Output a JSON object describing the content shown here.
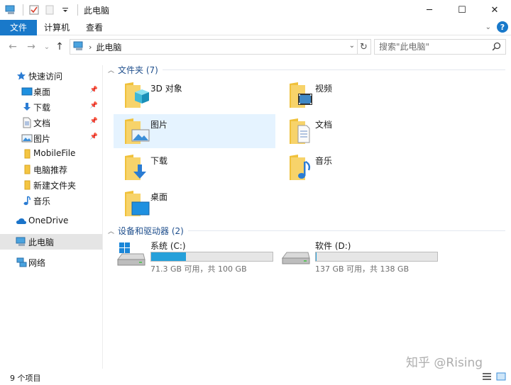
{
  "window": {
    "title": "此电脑",
    "controls": {
      "minimize": "─",
      "maximize": "☐",
      "close": "✕"
    }
  },
  "ribbon": {
    "tabs": [
      {
        "label": "文件"
      },
      {
        "label": "计算机"
      },
      {
        "label": "查看"
      }
    ],
    "help": "?",
    "expand": "⌄"
  },
  "nav": {
    "back": "←",
    "forward": "→",
    "recent": "⌄",
    "up": "↑",
    "breadcrumb": "此电脑",
    "dropdown": "⌄",
    "refresh": "↻",
    "search_placeholder": "搜索\"此电脑\""
  },
  "sidebar": {
    "quick_access": "快速访问",
    "items": [
      {
        "label": "桌面",
        "icon": "desktop-icon",
        "pinned": true
      },
      {
        "label": "下载",
        "icon": "download-icon",
        "pinned": true
      },
      {
        "label": "文档",
        "icon": "document-icon",
        "pinned": true
      },
      {
        "label": "图片",
        "icon": "picture-icon",
        "pinned": true
      },
      {
        "label": "MobileFile",
        "icon": "folder-icon",
        "pinned": false
      },
      {
        "label": "电脑推荐",
        "icon": "folder-icon",
        "pinned": false
      },
      {
        "label": "新建文件夹",
        "icon": "folder-icon",
        "pinned": false
      },
      {
        "label": "音乐",
        "icon": "music-icon",
        "pinned": false
      }
    ],
    "onedrive": "OneDrive",
    "this_pc": "此电脑",
    "network": "网络"
  },
  "folders_group": {
    "title": "文件夹 (7)",
    "items": [
      {
        "label": "3D 对象",
        "icon": "3d-objects-icon"
      },
      {
        "label": "视频",
        "icon": "video-icon"
      },
      {
        "label": "图片",
        "icon": "picture-icon"
      },
      {
        "label": "文档",
        "icon": "document-icon"
      },
      {
        "label": "下载",
        "icon": "download-icon"
      },
      {
        "label": "音乐",
        "icon": "music-icon"
      },
      {
        "label": "桌面",
        "icon": "desktop-icon"
      }
    ]
  },
  "drives_group": {
    "title": "设备和驱动器 (2)",
    "items": [
      {
        "label": "系统 (C:)",
        "free": "71.3 GB 可用，共 100 GB",
        "used_fraction": 0.287,
        "icon": "windows-drive-icon"
      },
      {
        "label": "软件 (D:)",
        "free": "137 GB 可用，共 138 GB",
        "used_fraction": 0.007,
        "icon": "drive-icon"
      }
    ]
  },
  "status": {
    "item_count": "9 个项目"
  },
  "watermark": "知乎 @Rising",
  "colors": {
    "accent": "#1979ca",
    "selection": "#cce8ff",
    "bar_fill": "#26a0da",
    "group_title": "#1e4e8c"
  }
}
